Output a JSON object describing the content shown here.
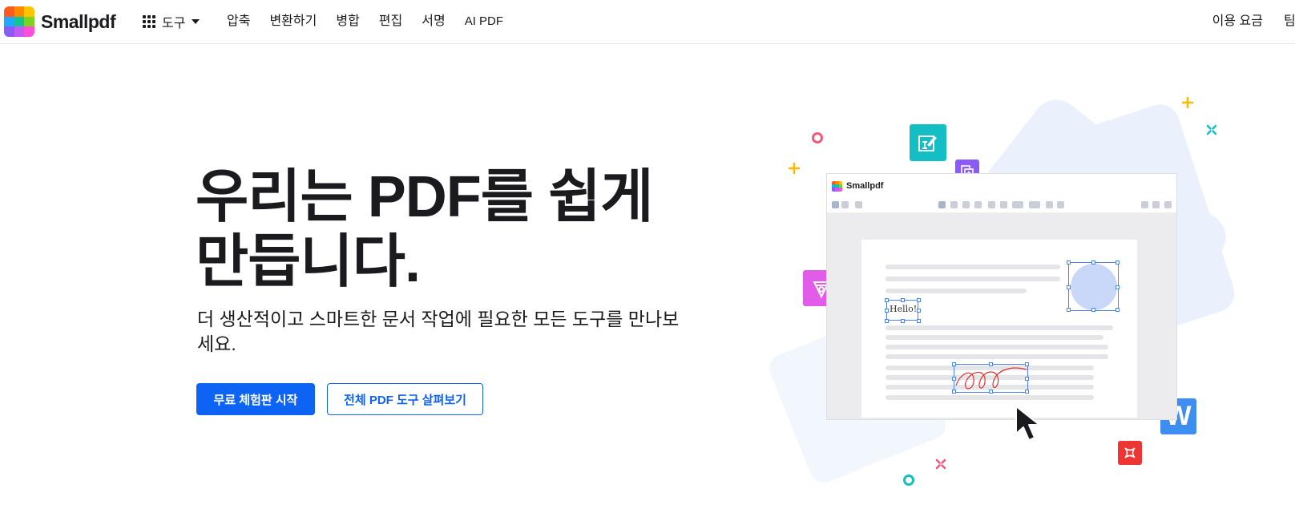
{
  "header": {
    "logo_text": "Smallpdf",
    "tools_label": "도구",
    "nav": [
      {
        "label": "압축"
      },
      {
        "label": "변환하기"
      },
      {
        "label": "병합"
      },
      {
        "label": "편집"
      },
      {
        "label": "서명"
      },
      {
        "label": "AI PDF"
      }
    ],
    "right_nav": [
      {
        "label": "이용 요금"
      },
      {
        "label": "팀"
      }
    ]
  },
  "hero": {
    "title": "우리는 PDF를 쉽게 만듭니다.",
    "subtitle": "더 생산적이고 스마트한 문서 작업에 필요한 모든 도구를 만나보세요.",
    "primary_button": "무료 체험판 시작",
    "secondary_button": "전체 PDF 도구 살펴보기"
  },
  "illustration": {
    "app_logo_text": "Smallpdf",
    "hello_text": "Hello!",
    "word_icon_letter": "W"
  },
  "colors": {
    "brand_blue": "#0d63f3",
    "text": "#1b1b1f",
    "teal": "#13bfc4",
    "purple": "#8a5cf5",
    "magenta": "#e15ce8",
    "yellow": "#ffb800",
    "red": "#ef3434",
    "word_blue": "#3d8ef0",
    "logo_squares": [
      "#ff5a1f",
      "#ff8a00",
      "#ffc400",
      "#1fa9ff",
      "#13c296",
      "#7ed321",
      "#8a5cf5",
      "#c05cf5",
      "#ff4fd8"
    ]
  }
}
